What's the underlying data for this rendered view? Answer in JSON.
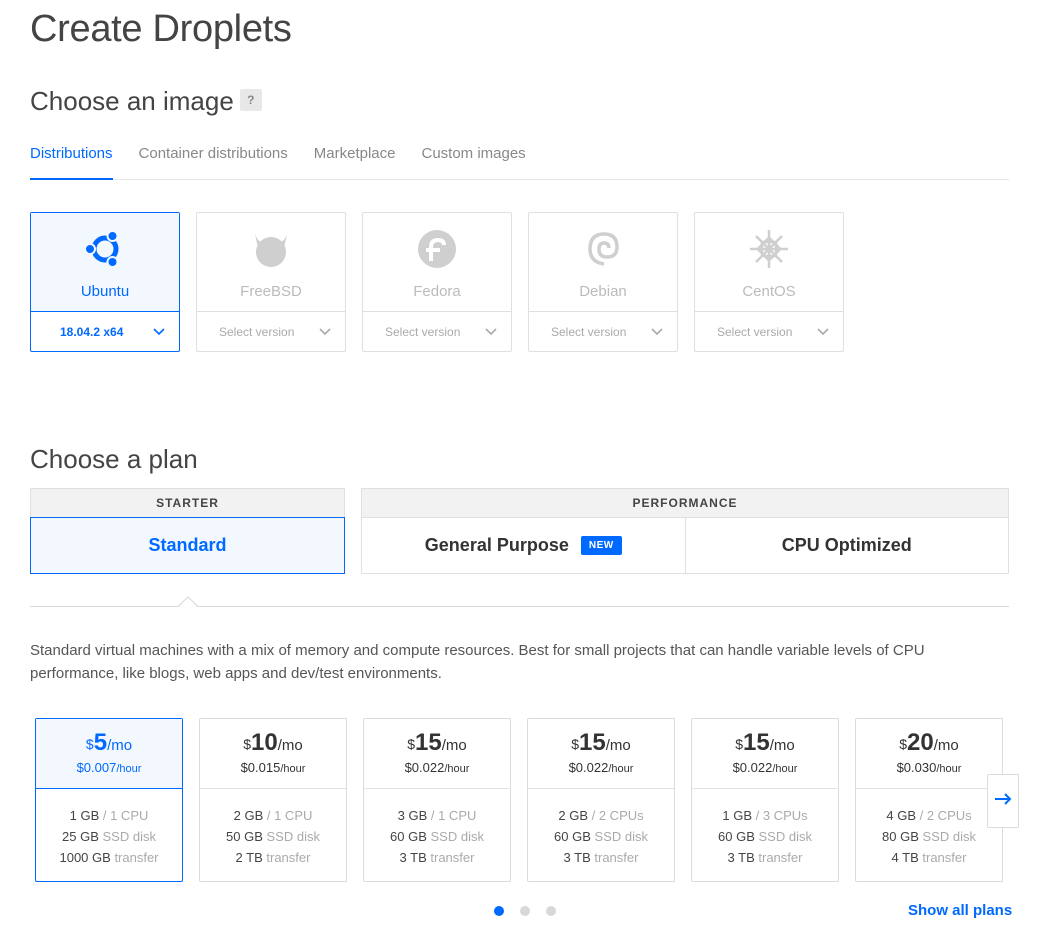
{
  "page": {
    "title": "Create Droplets"
  },
  "image_section": {
    "title": "Choose an image",
    "help": "?",
    "tabs": [
      {
        "label": "Distributions",
        "active": true
      },
      {
        "label": "Container distributions",
        "active": false
      },
      {
        "label": "Marketplace",
        "active": false
      },
      {
        "label": "Custom images",
        "active": false
      }
    ],
    "distros": [
      {
        "name": "Ubuntu",
        "version": "18.04.2 x64",
        "selected": true,
        "icon": "ubuntu-icon"
      },
      {
        "name": "FreeBSD",
        "version": "Select version",
        "selected": false,
        "icon": "freebsd-icon"
      },
      {
        "name": "Fedora",
        "version": "Select version",
        "selected": false,
        "icon": "fedora-icon"
      },
      {
        "name": "Debian",
        "version": "Select version",
        "selected": false,
        "icon": "debian-icon"
      },
      {
        "name": "CentOS",
        "version": "Select version",
        "selected": false,
        "icon": "centos-icon"
      }
    ]
  },
  "plan_section": {
    "title": "Choose a plan",
    "starter": {
      "header": "STARTER",
      "standard_label": "Standard"
    },
    "performance": {
      "header": "PERFORMANCE",
      "general_label": "General Purpose",
      "new_badge": "NEW",
      "cpu_label": "CPU Optimized"
    },
    "description": "Standard virtual machines with a mix of memory and compute resources. Best for small projects that can handle variable levels of CPU performance, like blogs, web apps and dev/test environments.",
    "sizes": [
      {
        "currency": "$",
        "price": "5",
        "per": "/mo",
        "hourly": "$0.007",
        "hourly_unit": "/hour",
        "mem": "1 GB",
        "cpu": "/ 1 CPU",
        "disk": "25 GB",
        "disk_label": "SSD disk",
        "transfer": "1000 GB",
        "transfer_label": "transfer",
        "selected": true
      },
      {
        "currency": "$",
        "price": "10",
        "per": "/mo",
        "hourly": "$0.015",
        "hourly_unit": "/hour",
        "mem": "2 GB",
        "cpu": "/ 1 CPU",
        "disk": "50 GB",
        "disk_label": "SSD disk",
        "transfer": "2 TB",
        "transfer_label": "transfer",
        "selected": false
      },
      {
        "currency": "$",
        "price": "15",
        "per": "/mo",
        "hourly": "$0.022",
        "hourly_unit": "/hour",
        "mem": "3 GB",
        "cpu": "/ 1 CPU",
        "disk": "60 GB",
        "disk_label": "SSD disk",
        "transfer": "3 TB",
        "transfer_label": "transfer",
        "selected": false
      },
      {
        "currency": "$",
        "price": "15",
        "per": "/mo",
        "hourly": "$0.022",
        "hourly_unit": "/hour",
        "mem": "2 GB",
        "cpu": "/ 2 CPUs",
        "disk": "60 GB",
        "disk_label": "SSD disk",
        "transfer": "3 TB",
        "transfer_label": "transfer",
        "selected": false
      },
      {
        "currency": "$",
        "price": "15",
        "per": "/mo",
        "hourly": "$0.022",
        "hourly_unit": "/hour",
        "mem": "1 GB",
        "cpu": "/ 3 CPUs",
        "disk": "60 GB",
        "disk_label": "SSD disk",
        "transfer": "3 TB",
        "transfer_label": "transfer",
        "selected": false
      },
      {
        "currency": "$",
        "price": "20",
        "per": "/mo",
        "hourly": "$0.030",
        "hourly_unit": "/hour",
        "mem": "4 GB",
        "cpu": "/ 2 CPUs",
        "disk": "80 GB",
        "disk_label": "SSD disk",
        "transfer": "4 TB",
        "transfer_label": "transfer",
        "selected": false
      }
    ],
    "pagination": {
      "pages": 3,
      "current": 1
    },
    "show_all": "Show all plans"
  },
  "colors": {
    "accent": "#0069ff",
    "selected_bg": "#f3f8ff",
    "border": "#e0e0e0",
    "muted_text": "#aaaaaa"
  }
}
